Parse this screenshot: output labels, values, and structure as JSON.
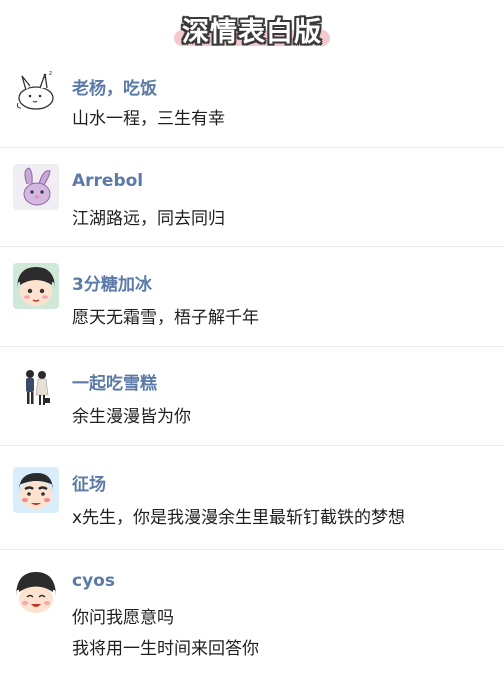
{
  "page": {
    "title": "深情表白版"
  },
  "comments": [
    {
      "username": "老杨，吃饭",
      "lines": [
        "山水一程，三生有幸"
      ],
      "avatar_icon": "bunny-doodle-icon"
    },
    {
      "username": "Arrebol",
      "lines": [
        "江湖路远，同去同归"
      ],
      "avatar_icon": "purple-bunny-icon"
    },
    {
      "username": "3分糖加冰",
      "lines": [
        "愿天无霜雪，梧子解千年"
      ],
      "avatar_icon": "cartoon-girl-icon"
    },
    {
      "username": "一起吃雪糕",
      "lines": [
        "余生漫漫皆为你"
      ],
      "avatar_icon": "couple-icon"
    },
    {
      "username": "征场",
      "lines": [
        "x先生，你是我漫漫余生里最斩钉截铁的梦想"
      ],
      "avatar_icon": "cartoon-boy-icon"
    },
    {
      "username": "cyos",
      "lines": [
        "你问我愿意吗",
        "我将用一生时间来回答你"
      ],
      "avatar_icon": "cartoon-girl-smile-icon"
    }
  ],
  "colors": {
    "username": "#5b7aa8",
    "text": "#1e1e1e",
    "divider": "#ececec",
    "title_highlight": "#f4c9cc"
  }
}
